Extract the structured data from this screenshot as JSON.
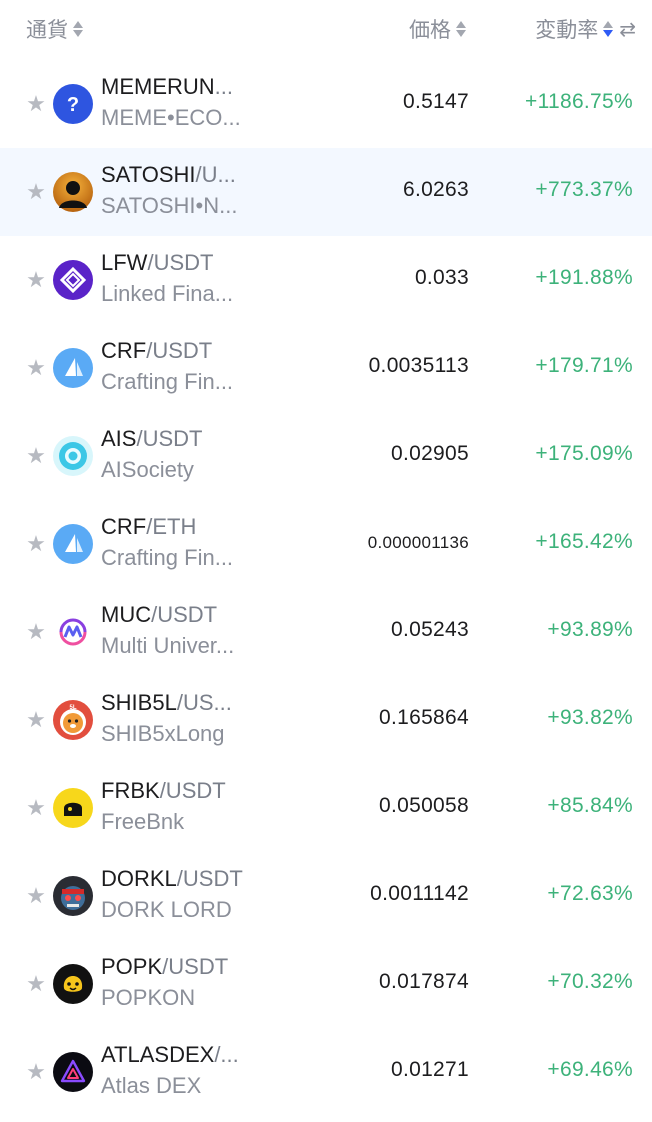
{
  "header": {
    "coin_label": "通貨",
    "price_label": "価格",
    "change_label": "変動率",
    "swap_glyph": "⇄"
  },
  "colors": {
    "positive": "#3db27a",
    "highlight": "#f3f8ff",
    "accent": "#2f5bf5"
  },
  "rows": [
    {
      "base": "MEMERUN",
      "quote": "...",
      "name": "MEME•ECO...",
      "price": "0.5147",
      "change": "+1186.75%",
      "icon": "question-icon"
    },
    {
      "base": "SATOSHI",
      "quote": "/U...",
      "name": "SATOSHI•N...",
      "price": "6.0263",
      "change": "+773.37%",
      "icon": "satoshi-icon"
    },
    {
      "base": "LFW",
      "quote": "/USDT",
      "name": "Linked Fina...",
      "price": "0.033",
      "change": "+191.88%",
      "icon": "lfw-icon"
    },
    {
      "base": "CRF",
      "quote": "/USDT",
      "name": "Crafting Fin...",
      "price": "0.0035113",
      "change": "+179.71%",
      "icon": "crf-icon"
    },
    {
      "base": "AIS",
      "quote": "/USDT",
      "name": "AISociety",
      "price": "0.02905",
      "change": "+175.09%",
      "icon": "ais-icon"
    },
    {
      "base": "CRF",
      "quote": "/ETH",
      "name": "Crafting Fin...",
      "price": "0.000001136",
      "change": "+165.42%",
      "icon": "crf-icon"
    },
    {
      "base": "MUC",
      "quote": "/USDT",
      "name": "Multi Univer...",
      "price": "0.05243",
      "change": "+93.89%",
      "icon": "muc-icon"
    },
    {
      "base": "SHIB5L",
      "quote": "/US...",
      "name": "SHIB5xLong",
      "price": "0.165864",
      "change": "+93.82%",
      "icon": "shib5l-icon"
    },
    {
      "base": "FRBK",
      "quote": "/USDT",
      "name": "FreeBnk",
      "price": "0.050058",
      "change": "+85.84%",
      "icon": "frbk-icon"
    },
    {
      "base": "DORKL",
      "quote": "/USDT",
      "name": "DORK LORD",
      "price": "0.0011142",
      "change": "+72.63%",
      "icon": "dorkl-icon"
    },
    {
      "base": "POPK",
      "quote": "/USDT",
      "name": "POPKON",
      "price": "0.017874",
      "change": "+70.32%",
      "icon": "popk-icon"
    },
    {
      "base": "ATLASDEX",
      "quote": "/...",
      "name": "Atlas DEX",
      "price": "0.01271",
      "change": "+69.46%",
      "icon": "atlasdex-icon"
    }
  ]
}
